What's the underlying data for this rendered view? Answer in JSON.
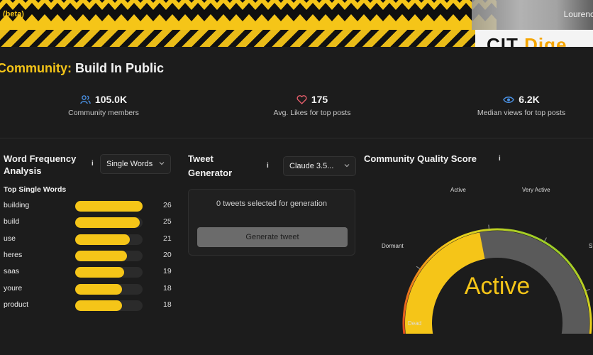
{
  "topbar": {
    "beta": "(beta)",
    "user": "Lourenc"
  },
  "banner": {
    "text_dark": "CIT ",
    "text_accent": "Dige"
  },
  "page": {
    "title_prefix": "Community:",
    "title_name": "Build In Public"
  },
  "stats": [
    {
      "icon": "users-icon",
      "value": "105.0K",
      "label": "Community members"
    },
    {
      "icon": "heart-icon",
      "value": "175",
      "label": "Avg. Likes for top posts"
    },
    {
      "icon": "eye-icon",
      "value": "6.2K",
      "label": "Median views for top posts"
    }
  ],
  "word_freq": {
    "title": "Word Frequency Analysis",
    "info": "i",
    "mode": "Single Words",
    "list_title": "Top Single Words",
    "max": 26,
    "items": [
      {
        "word": "building",
        "count": 26
      },
      {
        "word": "build",
        "count": 25
      },
      {
        "word": "use",
        "count": 21
      },
      {
        "word": "heres",
        "count": 20
      },
      {
        "word": "saas",
        "count": 19
      },
      {
        "word": "youre",
        "count": 18
      },
      {
        "word": "product",
        "count": 18
      }
    ]
  },
  "tweet_gen": {
    "title": "Tweet Generator",
    "info": "i",
    "model": "Claude 3.5...",
    "selected_text": "0 tweets selected for generation",
    "button": "Generate tweet"
  },
  "quality": {
    "title": "Community Quality Score",
    "info": "i",
    "value_label": "Active",
    "score_fraction": 0.45,
    "labels": {
      "dead": "Dead",
      "dormant": "Dormant",
      "active": "Active",
      "very_active": "Very Active",
      "s": "S"
    }
  },
  "colors": {
    "accent": "#f5c518",
    "background": "#1c1c1c",
    "users": "#4a90e2",
    "heart": "#e35d6a",
    "eye": "#4a90e2"
  }
}
